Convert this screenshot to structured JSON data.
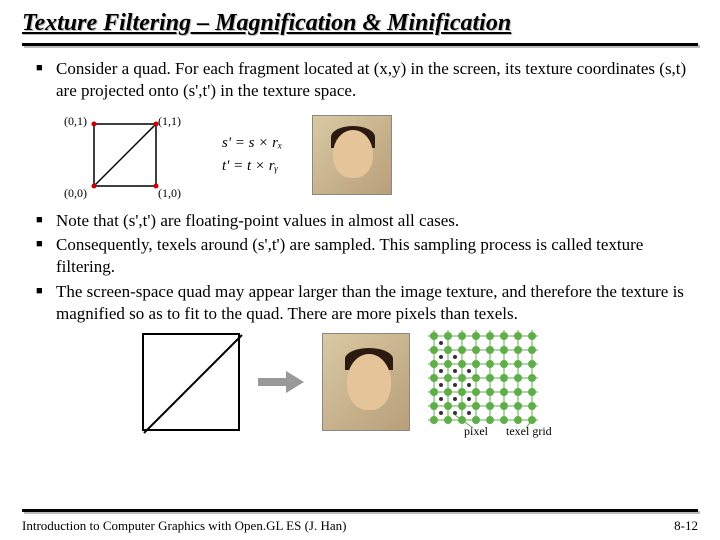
{
  "title": "Texture Filtering – Magnification & Minification",
  "bullets_a": [
    "Consider a quad. For each fragment located at (x,y) in the screen, its texture coordinates (s,t) are projected onto (s',t') in the texture space."
  ],
  "formula": {
    "line1": "s' = s × rₓ",
    "line2": "t' = t × rᵧ"
  },
  "coords": {
    "tl": "(0,1)",
    "tr": "(1,1)",
    "bl": "(0,0)",
    "br": "(1,0)"
  },
  "bullets_b": [
    "Note that (s',t') are floating-point values in almost all cases.",
    "Consequently, texels around (s',t') are sampled. This sampling process is called texture filtering.",
    "The screen-space quad may appear larger than the image texture, and therefore the texture is magnified so as to fit to the quad. There are more pixels than texels."
  ],
  "labels": {
    "pixel": "pixel",
    "texel_grid": "texel grid"
  },
  "footer": {
    "left": "Introduction to Computer Graphics with Open.GL ES (J. Han)",
    "right": "8-12"
  }
}
